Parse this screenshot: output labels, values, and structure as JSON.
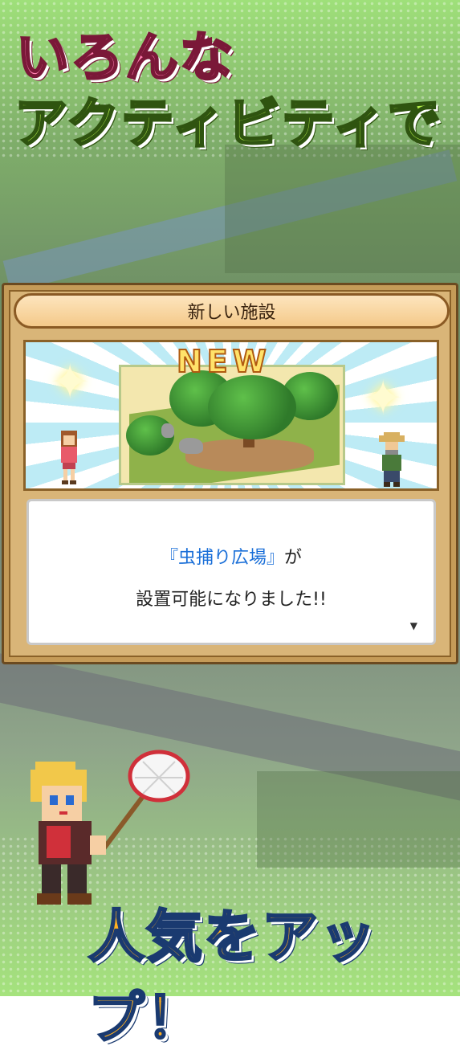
{
  "headline": {
    "line1": "いろんな",
    "line2": "アクティビティで",
    "bottom": "人気をアップ！"
  },
  "dialog": {
    "title": "新しい施設",
    "badge": "NEW",
    "message_highlight": "『虫捕り広場』",
    "message_suffix": "が",
    "message_line2": "設置可能になりました!!",
    "next_indicator": "▼"
  },
  "colors": {
    "headline_pink": "#ff7fb0",
    "headline_green": "#b6f14a",
    "headline_orange": "#ffb020",
    "highlight_blue": "#1a6fd8"
  }
}
